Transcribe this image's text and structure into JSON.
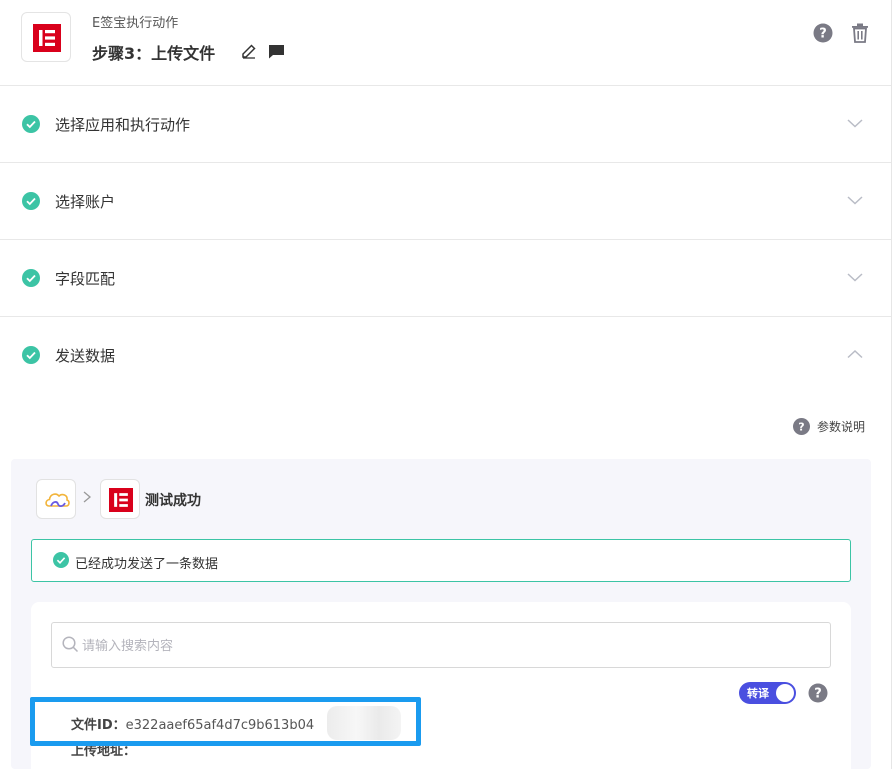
{
  "header": {
    "app_name": "E签宝执行动作",
    "step_title": "步骤3：上传文件"
  },
  "sections": [
    {
      "label": "选择应用和执行动作",
      "state": "collapsed"
    },
    {
      "label": "选择账户",
      "state": "collapsed"
    },
    {
      "label": "字段匹配",
      "state": "collapsed"
    },
    {
      "label": "发送数据",
      "state": "expanded"
    }
  ],
  "param_help": {
    "label": "参数说明"
  },
  "result": {
    "status": "测试成功",
    "success_message": "已经成功发送了一条数据",
    "search": {
      "placeholder": "请输入搜索内容",
      "value": ""
    },
    "translate_label": "转译",
    "translate_on": true,
    "fields": {
      "file_id_label": "文件ID：",
      "file_id_value": "e322aaef65af4d7c9b613b04",
      "upload_url_label": "上传地址："
    }
  },
  "colors": {
    "accent": "#4a4fe0",
    "success": "#3cc4a5",
    "brand_red": "#d9001b",
    "highlight": "#1a9bef"
  }
}
